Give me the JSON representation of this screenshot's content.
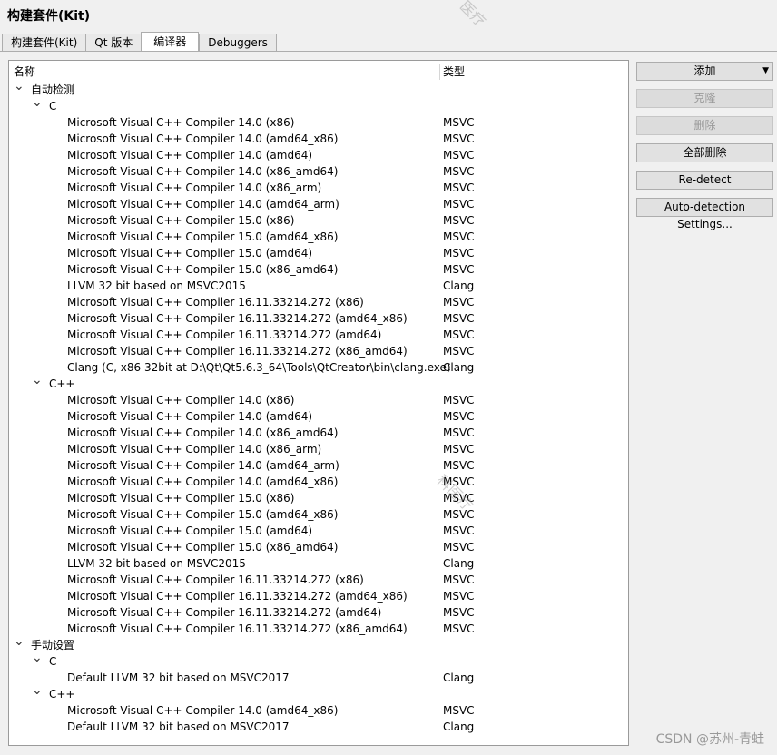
{
  "page_title": "构建套件(Kit)",
  "tabs": [
    {
      "label": "构建套件(Kit)",
      "active": false
    },
    {
      "label": "Qt 版本",
      "active": false
    },
    {
      "label": "编译器",
      "active": true
    },
    {
      "label": "Debuggers",
      "active": false
    }
  ],
  "tree": {
    "columns": {
      "name": "名称",
      "type": "类型"
    },
    "rows": [
      {
        "level": 0,
        "expandable": true,
        "name": "自动检测",
        "type": ""
      },
      {
        "level": 1,
        "expandable": true,
        "name": "C",
        "type": ""
      },
      {
        "level": 2,
        "expandable": false,
        "name": "Microsoft Visual C++ Compiler 14.0 (x86)",
        "type": "MSVC"
      },
      {
        "level": 2,
        "expandable": false,
        "name": "Microsoft Visual C++ Compiler 14.0 (amd64_x86)",
        "type": "MSVC"
      },
      {
        "level": 2,
        "expandable": false,
        "name": "Microsoft Visual C++ Compiler 14.0 (amd64)",
        "type": "MSVC"
      },
      {
        "level": 2,
        "expandable": false,
        "name": "Microsoft Visual C++ Compiler 14.0 (x86_amd64)",
        "type": "MSVC"
      },
      {
        "level": 2,
        "expandable": false,
        "name": "Microsoft Visual C++ Compiler 14.0 (x86_arm)",
        "type": "MSVC"
      },
      {
        "level": 2,
        "expandable": false,
        "name": "Microsoft Visual C++ Compiler 14.0 (amd64_arm)",
        "type": "MSVC"
      },
      {
        "level": 2,
        "expandable": false,
        "name": "Microsoft Visual C++ Compiler 15.0 (x86)",
        "type": "MSVC"
      },
      {
        "level": 2,
        "expandable": false,
        "name": "Microsoft Visual C++ Compiler 15.0 (amd64_x86)",
        "type": "MSVC"
      },
      {
        "level": 2,
        "expandable": false,
        "name": "Microsoft Visual C++ Compiler 15.0 (amd64)",
        "type": "MSVC"
      },
      {
        "level": 2,
        "expandable": false,
        "name": "Microsoft Visual C++ Compiler 15.0 (x86_amd64)",
        "type": "MSVC"
      },
      {
        "level": 2,
        "expandable": false,
        "name": "LLVM 32 bit based on MSVC2015",
        "type": "Clang"
      },
      {
        "level": 2,
        "expandable": false,
        "name": "Microsoft Visual C++ Compiler 16.11.33214.272 (x86)",
        "type": "MSVC"
      },
      {
        "level": 2,
        "expandable": false,
        "name": "Microsoft Visual C++ Compiler 16.11.33214.272 (amd64_x86)",
        "type": "MSVC"
      },
      {
        "level": 2,
        "expandable": false,
        "name": "Microsoft Visual C++ Compiler 16.11.33214.272 (amd64)",
        "type": "MSVC"
      },
      {
        "level": 2,
        "expandable": false,
        "name": "Microsoft Visual C++ Compiler 16.11.33214.272 (x86_amd64)",
        "type": "MSVC"
      },
      {
        "level": 2,
        "expandable": false,
        "name": "Clang (C, x86 32bit at D:\\Qt\\Qt5.6.3_64\\Tools\\QtCreator\\bin\\clang.exe)",
        "type": "Clang"
      },
      {
        "level": 1,
        "expandable": true,
        "name": "C++",
        "type": ""
      },
      {
        "level": 2,
        "expandable": false,
        "name": "Microsoft Visual C++ Compiler 14.0 (x86)",
        "type": "MSVC"
      },
      {
        "level": 2,
        "expandable": false,
        "name": "Microsoft Visual C++ Compiler 14.0 (amd64)",
        "type": "MSVC"
      },
      {
        "level": 2,
        "expandable": false,
        "name": "Microsoft Visual C++ Compiler 14.0 (x86_amd64)",
        "type": "MSVC"
      },
      {
        "level": 2,
        "expandable": false,
        "name": "Microsoft Visual C++ Compiler 14.0 (x86_arm)",
        "type": "MSVC"
      },
      {
        "level": 2,
        "expandable": false,
        "name": "Microsoft Visual C++ Compiler 14.0 (amd64_arm)",
        "type": "MSVC"
      },
      {
        "level": 2,
        "expandable": false,
        "name": "Microsoft Visual C++ Compiler 14.0 (amd64_x86)",
        "type": "MSVC"
      },
      {
        "level": 2,
        "expandable": false,
        "name": "Microsoft Visual C++ Compiler 15.0 (x86)",
        "type": "MSVC"
      },
      {
        "level": 2,
        "expandable": false,
        "name": "Microsoft Visual C++ Compiler 15.0 (amd64_x86)",
        "type": "MSVC"
      },
      {
        "level": 2,
        "expandable": false,
        "name": "Microsoft Visual C++ Compiler 15.0 (amd64)",
        "type": "MSVC"
      },
      {
        "level": 2,
        "expandable": false,
        "name": "Microsoft Visual C++ Compiler 15.0 (x86_amd64)",
        "type": "MSVC"
      },
      {
        "level": 2,
        "expandable": false,
        "name": "LLVM 32 bit based on MSVC2015",
        "type": "Clang"
      },
      {
        "level": 2,
        "expandable": false,
        "name": "Microsoft Visual C++ Compiler 16.11.33214.272 (x86)",
        "type": "MSVC"
      },
      {
        "level": 2,
        "expandable": false,
        "name": "Microsoft Visual C++ Compiler 16.11.33214.272 (amd64_x86)",
        "type": "MSVC"
      },
      {
        "level": 2,
        "expandable": false,
        "name": "Microsoft Visual C++ Compiler 16.11.33214.272 (amd64)",
        "type": "MSVC"
      },
      {
        "level": 2,
        "expandable": false,
        "name": "Microsoft Visual C++ Compiler 16.11.33214.272 (x86_amd64)",
        "type": "MSVC"
      },
      {
        "level": 0,
        "expandable": true,
        "name": "手动设置",
        "type": ""
      },
      {
        "level": 1,
        "expandable": true,
        "name": "C",
        "type": ""
      },
      {
        "level": 2,
        "expandable": false,
        "name": "Default LLVM 32 bit based on MSVC2017",
        "type": "Clang"
      },
      {
        "level": 1,
        "expandable": true,
        "name": "C++",
        "type": ""
      },
      {
        "level": 2,
        "expandable": false,
        "name": "Microsoft Visual C++ Compiler 14.0 (amd64_x86)",
        "type": "MSVC"
      },
      {
        "level": 2,
        "expandable": false,
        "name": "Default LLVM 32 bit based on MSVC2017",
        "type": "Clang"
      }
    ]
  },
  "buttons": {
    "add": "添加",
    "clone": "克隆",
    "remove": "删除",
    "remove_all": "全部删除",
    "redetect": "Re-detect",
    "auto_detection_settings": "Auto-detection Settings..."
  },
  "icons": {
    "expand": "chevron-down-icon",
    "dropdown": "triangle-down-icon"
  },
  "watermark": {
    "text1": "医疗",
    "text2": "科医疗"
  },
  "credit": "CSDN @苏州-青蛙"
}
